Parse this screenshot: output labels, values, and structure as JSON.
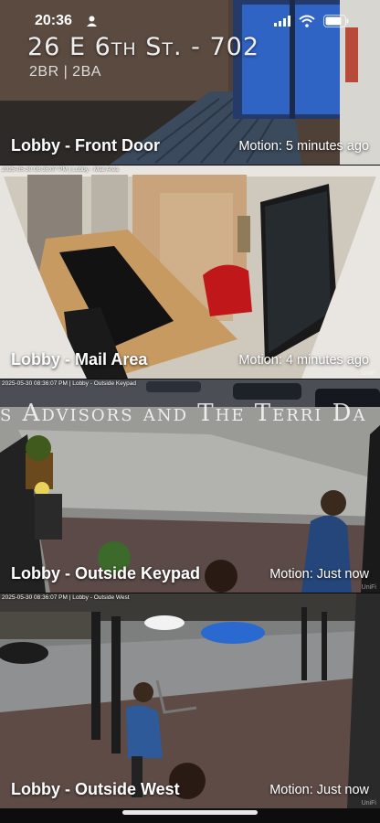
{
  "status_bar": {
    "time": "20:36"
  },
  "property": {
    "address": "26 E 6th St. - 702",
    "details": "2BR | 2BA"
  },
  "cameras": [
    {
      "name": "Lobby - Front Door",
      "motion": "Motion: 5 minutes ago",
      "timestamp": "",
      "brand": ""
    },
    {
      "name": "Lobby - Mail Area",
      "motion": "Motion: 4 minutes ago",
      "timestamp": "2025-05-30 08:36:07 PM | Lobby - Mail Area",
      "brand": "UniFi"
    },
    {
      "name": "Lobby - Outside Keypad",
      "motion": "Motion: Just now",
      "timestamp": "2025-05-30 08:36:07 PM | Lobby - Outside Keypad",
      "brand": "UniFi",
      "scene_text": "s Advisors and The Terri Da"
    },
    {
      "name": "Lobby - Outside West",
      "motion": "Motion: Just now",
      "timestamp": "2025-05-30 08:36:07 PM | Lobby - Outside West",
      "brand": "UniFi"
    }
  ],
  "colors": {
    "label_text": "#ffffff",
    "background": "#0d0d0d"
  }
}
